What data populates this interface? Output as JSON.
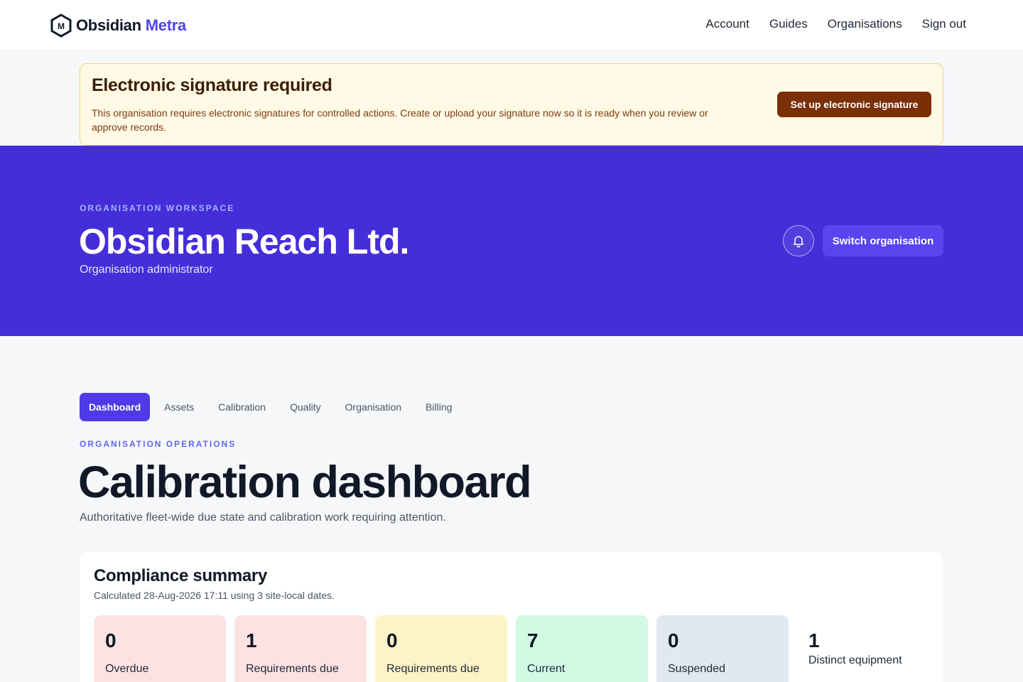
{
  "brand": {
    "name": "Obsidian",
    "accent": "Metra",
    "logo_letter": "M"
  },
  "nav": {
    "links": [
      "Account",
      "Guides",
      "Organisations",
      "Sign out"
    ]
  },
  "signature_banner": {
    "title": "Electronic signature required",
    "text": "This organisation requires electronic signatures for controlled actions. Create or upload your signature now so it is ready when you review or approve records.",
    "button": "Set up electronic signature"
  },
  "hero": {
    "eyebrow": "ORGANISATION WORKSPACE",
    "title": "Obsidian Reach Ltd.",
    "subtitle": "Organisation administrator",
    "bell_icon": "bell-icon",
    "switch_button": "Switch organisation"
  },
  "tabs": [
    "Dashboard",
    "Assets",
    "Calibration",
    "Quality",
    "Organisation",
    "Billing"
  ],
  "active_tab": "Dashboard",
  "page": {
    "eyebrow": "ORGANISATION OPERATIONS",
    "title": "Calibration dashboard",
    "description": "Authoritative fleet-wide due state and calibration work requiring attention."
  },
  "summary": {
    "title": "Compliance summary",
    "calculated": "Calculated 28-Aug-2026 17:11 using 3 site-local dates.",
    "metrics": [
      {
        "value": "0",
        "label": "Overdue",
        "color": "#fde2e2"
      },
      {
        "value": "1",
        "label": "Requirements due",
        "color": "#fde2e2"
      },
      {
        "value": "0",
        "label": "Requirements due",
        "color": "#fef3c7"
      },
      {
        "value": "7",
        "label": "Current",
        "color": "#d1fae5"
      },
      {
        "value": "0",
        "label": "Suspended",
        "color": "#e2e8f0"
      },
      {
        "value": "1",
        "label": "Distinct equipment",
        "color": "#ffffff"
      }
    ]
  },
  "colors": {
    "primary": "#4f46e5",
    "hero_bg": "#452ed9",
    "banner_bg": "#fff9e5",
    "banner_button": "#7a2f06"
  }
}
